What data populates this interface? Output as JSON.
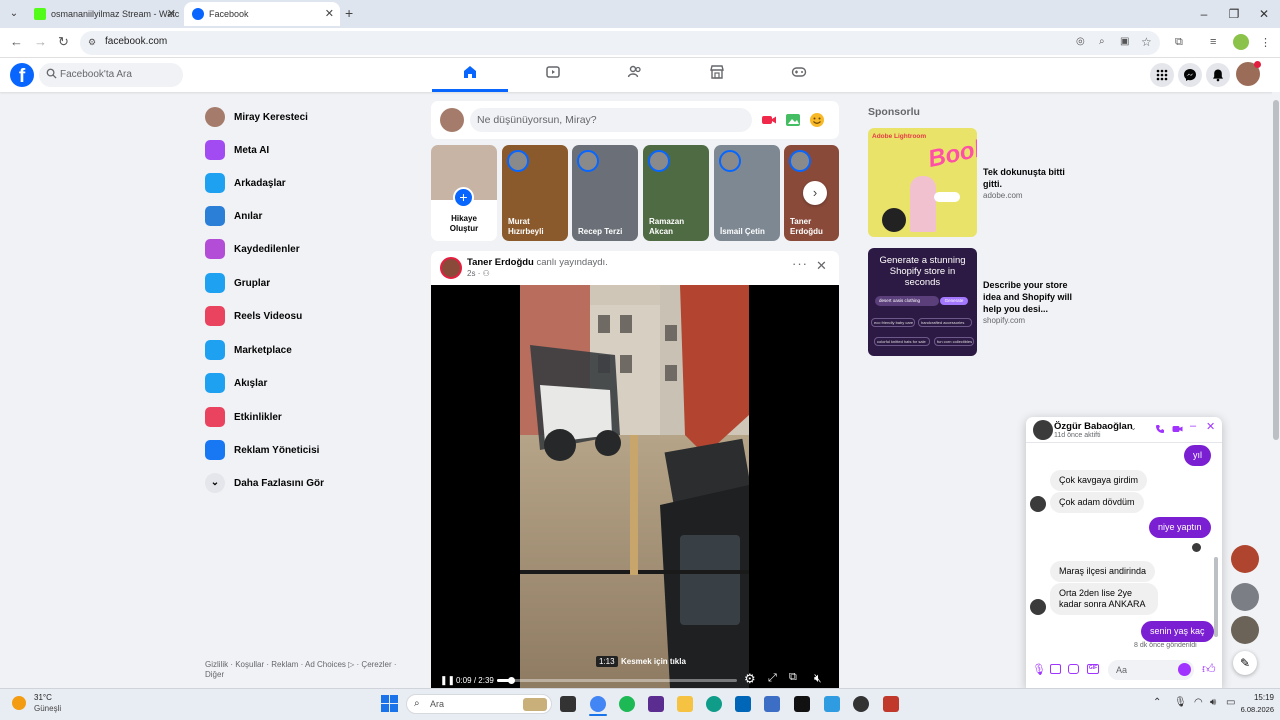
{
  "browser": {
    "tabs": [
      {
        "title": "osmananiilyilmaz Stream - Watc",
        "active": false
      },
      {
        "title": "Facebook",
        "active": true
      }
    ],
    "url": "facebook.com"
  },
  "header": {
    "search_placeholder": "Facebook'ta Ara"
  },
  "sidebar": {
    "items": [
      {
        "label": "Miray Keresteci",
        "icon": "avatar",
        "color": "#a57c6b"
      },
      {
        "label": "Meta AI",
        "icon": "meta-ai-icon",
        "color": "#a24bf2"
      },
      {
        "label": "Arkadaşlar",
        "icon": "friends-icon",
        "color": "#1ea1f1"
      },
      {
        "label": "Anılar",
        "icon": "memories-icon",
        "color": "#2b7fd6"
      },
      {
        "label": "Kaydedilenler",
        "icon": "saved-icon",
        "color": "#b34dd8"
      },
      {
        "label": "Gruplar",
        "icon": "groups-icon",
        "color": "#1ea1f1"
      },
      {
        "label": "Reels Videosu",
        "icon": "reels-icon",
        "color": "#e9435f"
      },
      {
        "label": "Marketplace",
        "icon": "marketplace-icon",
        "color": "#1ea1f1"
      },
      {
        "label": "Akışlar",
        "icon": "feeds-icon",
        "color": "#1ea1f1"
      },
      {
        "label": "Etkinlikler",
        "icon": "events-icon",
        "color": "#e9435f"
      },
      {
        "label": "Reklam Yöneticisi",
        "icon": "ads-manager-icon",
        "color": "#1877f2"
      },
      {
        "label": "Daha Fazlasını Gör",
        "icon": "chevron-down-icon",
        "color": "#e4e6eb"
      }
    ],
    "footer": "Gizlilik · Koşullar · Reklam · Ad Choices ▷ · Çerezler · Diğer"
  },
  "composer": {
    "placeholder": "Ne düşünüyorsun, Miray?"
  },
  "stories": [
    {
      "name": "Hikaye Oluştur",
      "color": "#c8b4a4"
    },
    {
      "name": "Murat Hızırbeyli",
      "color": "#8a5a2c"
    },
    {
      "name": "Recep Terzi",
      "color": "#6b7078"
    },
    {
      "name": "Ramazan Akcan",
      "color": "#4f6b43"
    },
    {
      "name": "İsmail Çetin",
      "color": "#7d8893"
    },
    {
      "name": "Taner Erdoğdu",
      "color": "#8a4a3a"
    }
  ],
  "post": {
    "author": "Taner Erdoğdu",
    "action": "canlı yayındaydı.",
    "time": "2s",
    "video": {
      "current_time": "0:09",
      "duration": "2:39",
      "hover_time": "1:13",
      "overlay_text": "Kesmek için tıkla",
      "progress_fraction": 0.057
    }
  },
  "sponsored": {
    "heading": "Sponsorlu",
    "ads": [
      {
        "title": "Tek dokunuşta bitti gitti.",
        "domain": "adobe.com",
        "brand": "Adobe Lightroom",
        "image_text": "Book"
      },
      {
        "title": "Describe your store idea and Shopify will help you desi...",
        "domain": "shopify.com",
        "image_text": "Generate a stunning Shopify store in seconds",
        "chips": [
          "desert oasis clothing",
          "Generate",
          "eco friendly baby care",
          "handcrafted accessories",
          "colorful knitted hats for sale",
          "fun corn collectibles"
        ]
      }
    ]
  },
  "chat": {
    "name": "Özgür Babaoğlan",
    "status": "11d önce aktifti",
    "input_placeholder": "Aa",
    "messages": [
      {
        "from": "me",
        "text": "yıl"
      },
      {
        "from": "them",
        "text": "Çok kavgaya girdim"
      },
      {
        "from": "them",
        "text": "Çok adam dövdüm"
      },
      {
        "from": "me",
        "text": "niye yaptın"
      },
      {
        "from": "them",
        "text": "Maraş ilçesi andirinda"
      },
      {
        "from": "them",
        "text": "Orta 2den lise 2ye kadar sonra ANKARA"
      },
      {
        "from": "me",
        "text": "senin yaş kaç"
      }
    ],
    "sent_status": "8 dk önce gönderildi"
  },
  "taskbar": {
    "weather_temp": "31°C",
    "weather_desc": "Güneşli",
    "search_placeholder": "Ara",
    "time": "15:19",
    "date": "6.08.2026"
  },
  "colors": {
    "fb_blue": "#0866ff",
    "messenger_purple": "#7a1fd1"
  }
}
